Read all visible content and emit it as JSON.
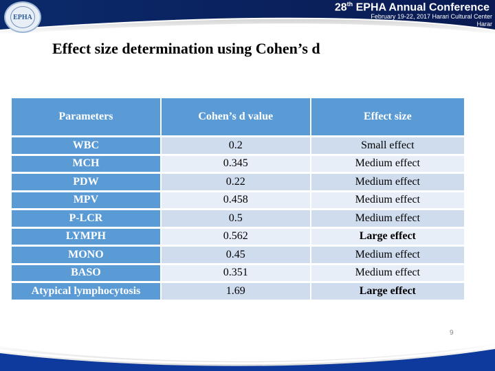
{
  "header": {
    "conference_title_number": "28",
    "conference_title_suffix": "th",
    "conference_title_rest": " EPHA Annual Conference",
    "conference_subtitle": "February 19-22, 2017   Harari Cultural Center",
    "conference_city": "Harar",
    "logo_text": "EPHA"
  },
  "slide": {
    "title": "Effect size determination using Cohen’s d",
    "page_number": "9"
  },
  "table": {
    "headers": [
      "Parameters",
      "Cohen’s d value",
      "Effect size"
    ],
    "rows": [
      {
        "parameter": "WBC",
        "value": "0.2",
        "effect": "Small effect",
        "bold": false
      },
      {
        "parameter": "MCH",
        "value": "0.345",
        "effect": "Medium effect",
        "bold": false
      },
      {
        "parameter": "PDW",
        "value": "0.22",
        "effect": "Medium effect",
        "bold": false
      },
      {
        "parameter": "MPV",
        "value": "0.458",
        "effect": "Medium effect",
        "bold": false
      },
      {
        "parameter": "P-LCR",
        "value": "0.5",
        "effect": "Medium effect",
        "bold": false
      },
      {
        "parameter": "LYMPH",
        "value": "0.562",
        "effect": "Large effect",
        "bold": true
      },
      {
        "parameter": "MONO",
        "value": "0.45",
        "effect": "Medium effect",
        "bold": false
      },
      {
        "parameter": "BASO",
        "value": "0.351",
        "effect": "Medium effect",
        "bold": false
      },
      {
        "parameter": "Atypical lymphocytosis",
        "value": "1.69",
        "effect": "Large effect",
        "bold": true
      }
    ]
  },
  "colors": {
    "header_navy": "#0b1f5c",
    "footer_blue": "#0d3a9c",
    "table_header": "#5b9bd5",
    "row_dark": "#cfdcee",
    "row_light": "#e8eef7"
  }
}
